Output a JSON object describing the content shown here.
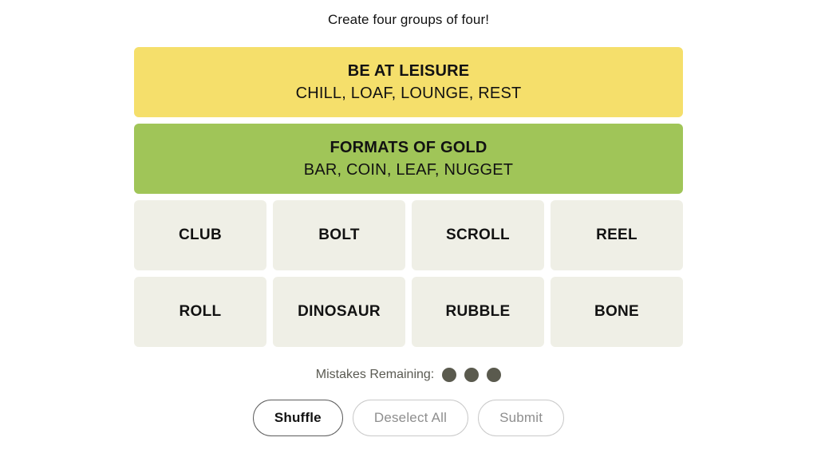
{
  "header": {
    "instruction": "Create four groups of four!"
  },
  "board": {
    "solved_groups": [
      {
        "title": "BE AT LEISURE",
        "members": "CHILL, LOAF, LOUNGE, REST",
        "color": "#f5df6b",
        "difficulty": "yellow"
      },
      {
        "title": "FORMATS OF GOLD",
        "members": "BAR, COIN, LEAF, NUGGET",
        "color": "#a0c558",
        "difficulty": "green"
      }
    ],
    "tile_color": "#efefe6",
    "rows": [
      {
        "tiles": [
          {
            "label": "CLUB"
          },
          {
            "label": "BOLT"
          },
          {
            "label": "SCROLL"
          },
          {
            "label": "REEL"
          }
        ]
      },
      {
        "tiles": [
          {
            "label": "ROLL"
          },
          {
            "label": "DINOSAUR"
          },
          {
            "label": "RUBBLE"
          },
          {
            "label": "BONE"
          }
        ]
      }
    ]
  },
  "mistakes": {
    "label": "Mistakes Remaining:",
    "remaining": 3,
    "dot_color": "#5a5a4e"
  },
  "buttons": {
    "shuffle": "Shuffle",
    "deselect_all": "Deselect All",
    "submit": "Submit"
  }
}
